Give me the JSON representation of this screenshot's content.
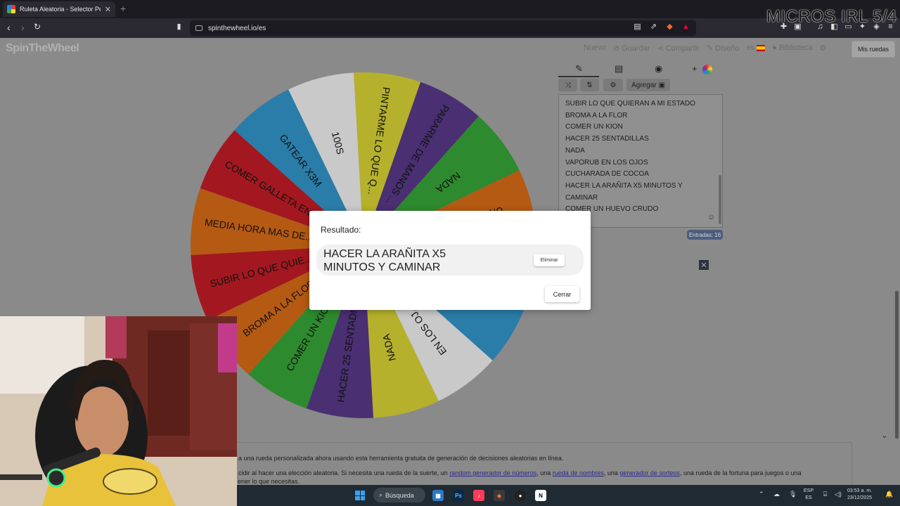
{
  "browser": {
    "tab_title": "Ruleta Aleatoria - Selector Perso",
    "tab_close": "✕",
    "new_tab": "+",
    "url": "spinthewheel.io/es"
  },
  "overlay": {
    "text": "MICROS IRL 5/4"
  },
  "site": {
    "logo": "SpinTheWheel",
    "nav": {
      "nuevo": "Nuevo",
      "guardar": "Guardar",
      "compartir": "Compartir",
      "diseno": "Diseño",
      "lang": "es",
      "biblioteca": "Biblioteca",
      "mis_ruedas": "Mis ruedas"
    }
  },
  "wheel": {
    "segments": [
      {
        "label": "PINTARME LO QUE Q...",
        "color": "#b5b12c"
      },
      {
        "label": "PARARME DE MANOS ...",
        "color": "#4a2f72"
      },
      {
        "label": "NADA",
        "color": "#2e8a2e"
      },
      {
        "label": "UN HUEVO CR...",
        "color": "#b55a12"
      },
      {
        "label": "",
        "color": "#8a8a8a"
      },
      {
        "label": "",
        "color": "#2a7da8"
      },
      {
        "label": "EN LOS OJ...",
        "color": "#c9c9c9"
      },
      {
        "label": "NADA",
        "color": "#b5b12c"
      },
      {
        "label": "HACER 25 SENTADIL...",
        "color": "#4a2f72"
      },
      {
        "label": "COMER UN KION",
        "color": "#2e8a2e"
      },
      {
        "label": "BROMA A LA FLOR",
        "color": "#b55a12"
      },
      {
        "label": "SUBIR LO QUE QUIE...",
        "color": "#a31820"
      },
      {
        "label": "MEDIA HORA MAS DE...",
        "color": "#b55a12"
      },
      {
        "label": "COMER GALLETA EN ...",
        "color": "#a31820"
      },
      {
        "label": "GATEAR X3M",
        "color": "#2a7da8"
      },
      {
        "label": "100S",
        "color": "#c9c9c9"
      }
    ]
  },
  "editor": {
    "agregar": "Agregar",
    "entries": [
      "SUBIR LO QUE QUIERAN A MI ESTADO",
      "BROMA A LA FLOR",
      "COMER UN KION",
      "HACER 25 SENTADILLAS",
      "NADA",
      "VAPORUB EN LOS OJOS",
      "CUCHARADA DE COCOA",
      "HACER LA ARAÑITA X5 MINUTOS Y",
      "CAMINAR",
      "COMER UN HUEVO CRUDO"
    ],
    "count": "Entradas: 16"
  },
  "modal": {
    "title": "Resultado:",
    "result_line1": "HACER LA ARAÑITA X5",
    "result_line2": "MINUTOS Y CAMINAR",
    "remove": "Eliminar",
    "close": "Cerrar"
  },
  "info": {
    "line1": "a una rueda personalizada ahora usando esta herramienta gratuita de generación de decisiones aleatorias en línea.",
    "line2_a": "cidir al hacer una elección aleatoria. Si necesita una rueda de la suerte, un ",
    "link1": "random generador de números",
    "line2_b": ", una ",
    "link2": "rueda de nombres",
    "line2_c": ", una ",
    "link3": "generador de sorteos",
    "line2_d": ", una rueda de la fortuna para juegos o una",
    "line3": "ener lo que necesitas."
  },
  "taskbar": {
    "search": "Búsqueda",
    "lang1": "ESP",
    "lang2": "ES",
    "time": "03:53 a. m.",
    "date": "23/12/2025"
  },
  "colors": {
    "page_bg": "#8a8a8a",
    "modal_bg": "#ffffff",
    "badge": "#4e5c7a"
  }
}
